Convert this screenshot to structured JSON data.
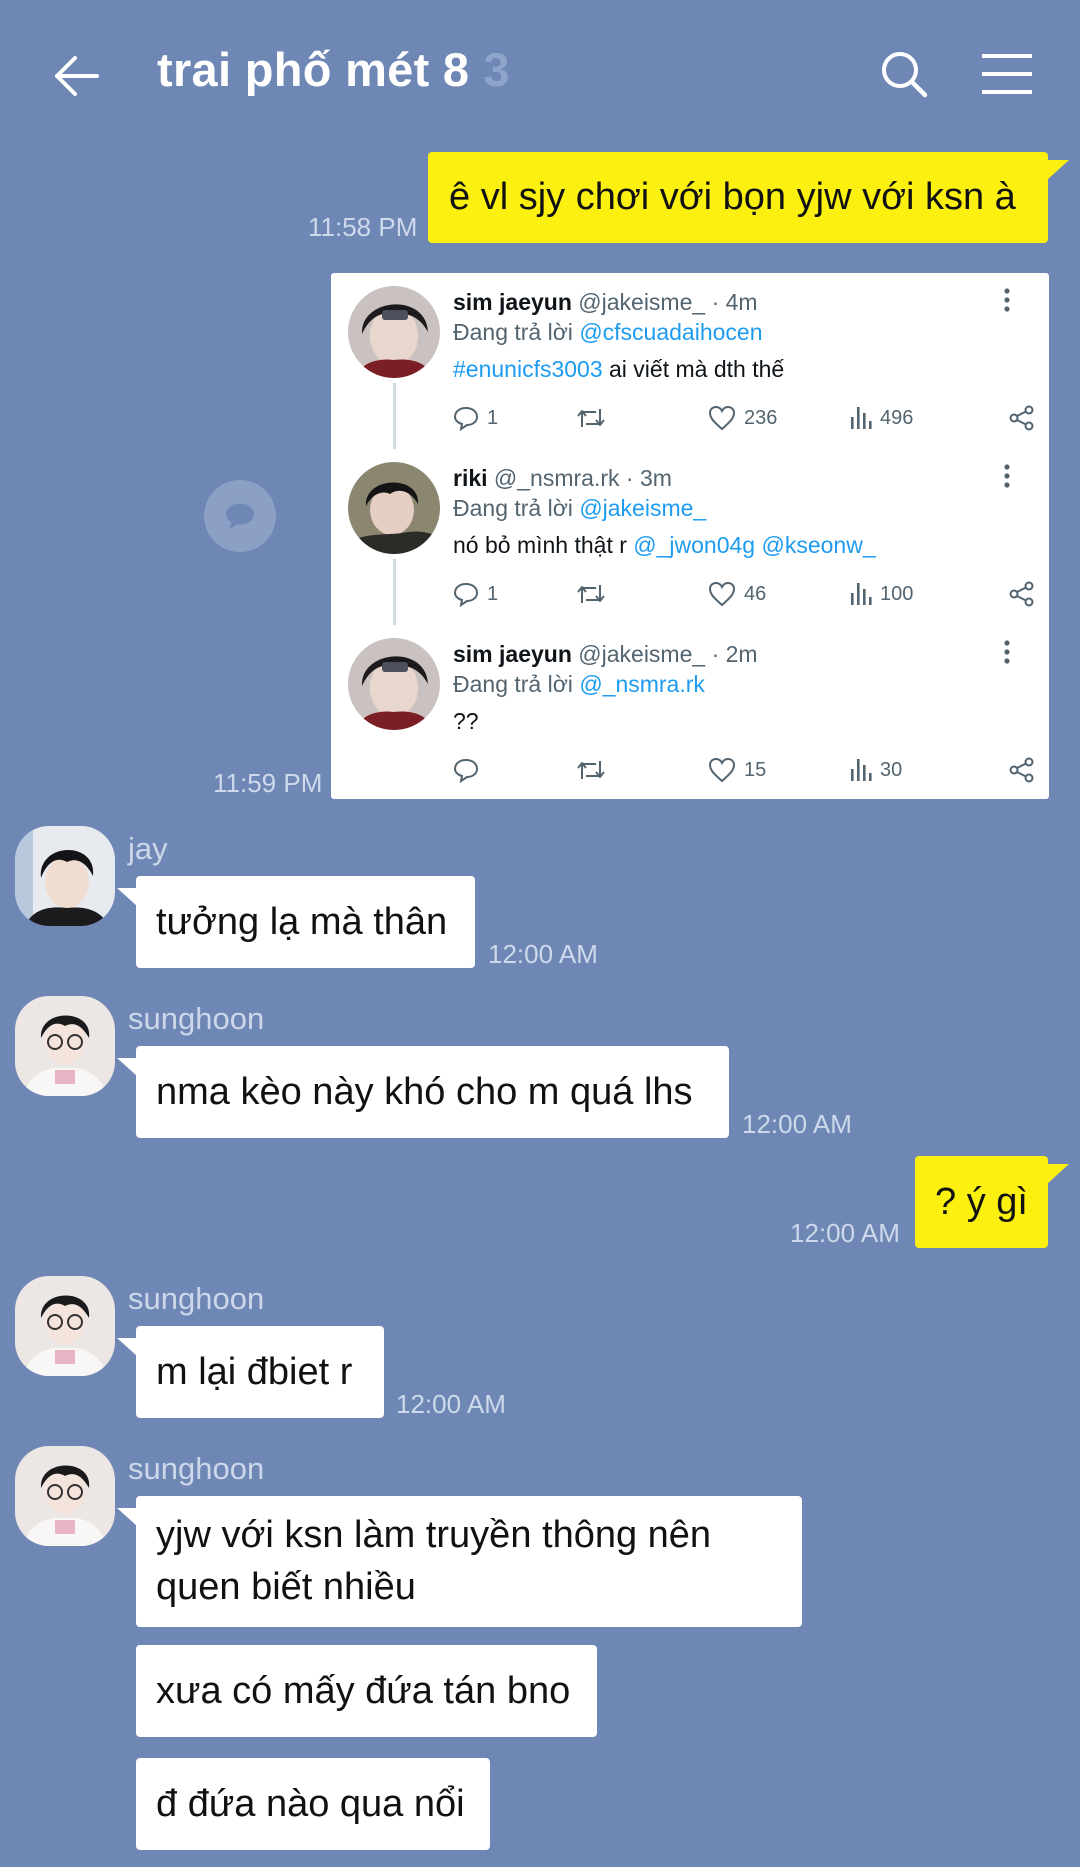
{
  "header": {
    "title": "trai phố mét 8",
    "member_count": "3",
    "back_icon": "arrow-left-icon",
    "search_icon": "search-icon",
    "menu_icon": "hamburger-menu-icon"
  },
  "colors": {
    "background": "#6e87b5",
    "my_bubble": "#fbf00f",
    "their_bubble": "#ffffff",
    "link": "#1d9bf0"
  },
  "messages": {
    "m1": {
      "text": "ê vl sjy chơi với bọn yjw với ksn à",
      "time": "11:58 PM"
    },
    "m2": {
      "time": "11:59 PM"
    },
    "m3": {
      "sender": "jay",
      "text": "tưởng lạ mà thân",
      "time": "12:00 AM"
    },
    "m4": {
      "sender": "sunghoon",
      "text": "nma kèo này khó cho m quá lhs",
      "time": "12:00 AM"
    },
    "m5": {
      "text": "? ý gì",
      "time": "12:00 AM"
    },
    "m6": {
      "sender": "sunghoon",
      "text": "m lại đbiet r",
      "time": "12:00 AM"
    },
    "m7": {
      "sender": "sunghoon",
      "line1": "yjw với ksn làm truyền thông nên",
      "line2": "quen biết nhiều",
      "text2": "xưa có mấy đứa tán bno",
      "text3": "đ đứa nào qua nổi"
    }
  },
  "tweets": [
    {
      "name": "sim jaeyun",
      "handle": "@jakeisme_ · 4m",
      "reply_prefix": "Đang trả lời ",
      "reply_to": "@cfscuadaihocen",
      "body_link": "#enunicfs3003",
      "body_text": " ai viết mà dth thế",
      "replies": "1",
      "likes": "236",
      "views": "496"
    },
    {
      "name": "riki",
      "handle": "@_nsmra.rk · 3m",
      "reply_prefix": "Đang trả lời ",
      "reply_to": "@jakeisme_",
      "body_text": "nó bỏ mình thật r ",
      "mention1": "@_jwon04g",
      "mention2": "@kseonw_",
      "replies": "1",
      "likes": "46",
      "views": "100"
    },
    {
      "name": "sim jaeyun",
      "handle": "@jakeisme_ · 2m",
      "reply_prefix": "Đang trả lời ",
      "reply_to": "@_nsmra.rk",
      "body_text": "??",
      "likes": "15",
      "views": "30"
    }
  ]
}
